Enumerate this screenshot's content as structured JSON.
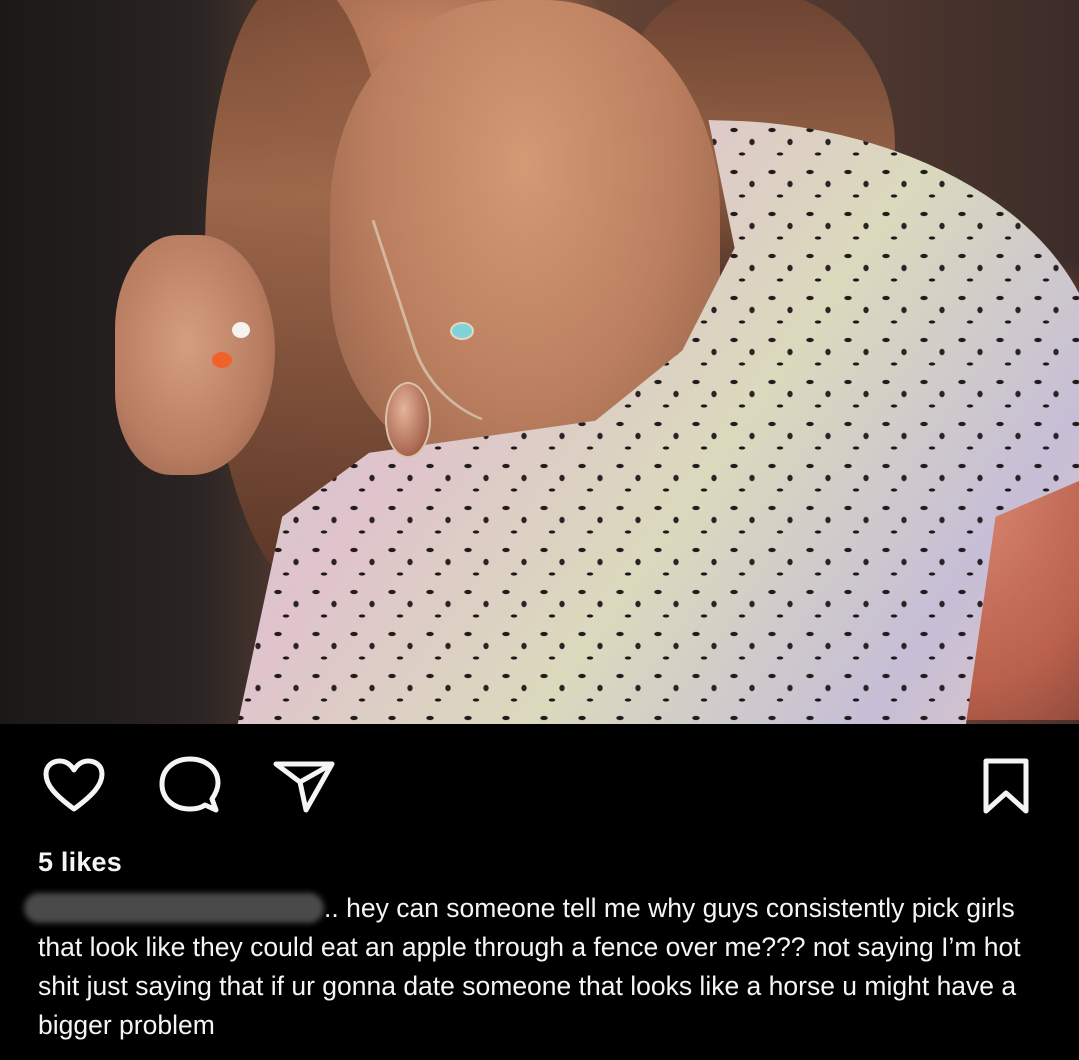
{
  "post": {
    "likes_text": "5 likes",
    "caption_prefix": "..",
    "caption_text": "hey can someone tell me why guys consistently pick girls that look like they could eat an apple through a fence over me??? not saying I’m hot shit just saying that if ur gonna date someone that looks like a horse u might have a bigger problem"
  },
  "actions": {
    "icons": [
      "heart-icon",
      "comment-icon",
      "share-icon",
      "bookmark-icon"
    ]
  },
  "colors": {
    "background": "#000000",
    "text": "#f5f5f5"
  }
}
